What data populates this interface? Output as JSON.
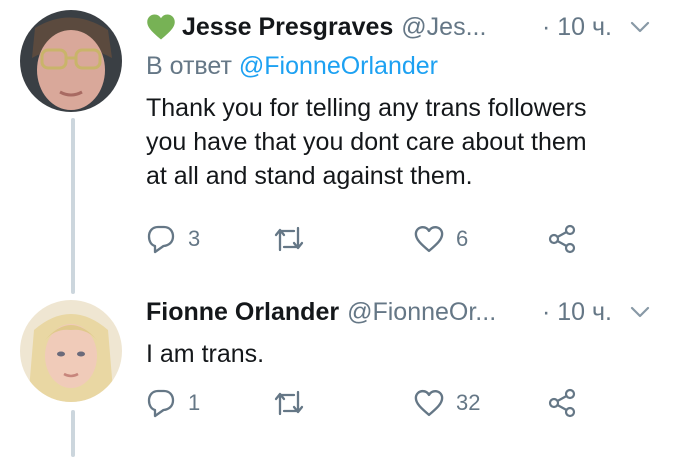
{
  "tweets": [
    {
      "author_name": "Jesse Presgraves",
      "has_green_heart": true,
      "handle": "@Jes...",
      "time": "· 10 ч.",
      "reply_prefix": "В ответ",
      "reply_to": "@FionneOrlander",
      "text_lines": [
        "Thank you for telling any trans followers",
        "you have that you dont care about them",
        "at all and stand against them."
      ],
      "reply_count": "3",
      "retweet_count": "",
      "like_count": "6"
    },
    {
      "author_name": "Fionne Orlander",
      "handle": "@FionneOr...",
      "time": "· 10 ч.",
      "text_lines": [
        "I am trans."
      ],
      "reply_count": "1",
      "retweet_count": "",
      "like_count": "32"
    }
  ],
  "colors": {
    "text": "#14171a",
    "secondary": "#657786",
    "link": "#1da1f2",
    "heart_emoji": "#77b255",
    "thread_line": "#ccd6dd"
  },
  "icons": {
    "reply": "reply-icon",
    "retweet": "retweet-icon",
    "like": "like-icon",
    "share": "share-icon",
    "menu": "chevron-down-icon",
    "badge": "green-heart-icon"
  }
}
